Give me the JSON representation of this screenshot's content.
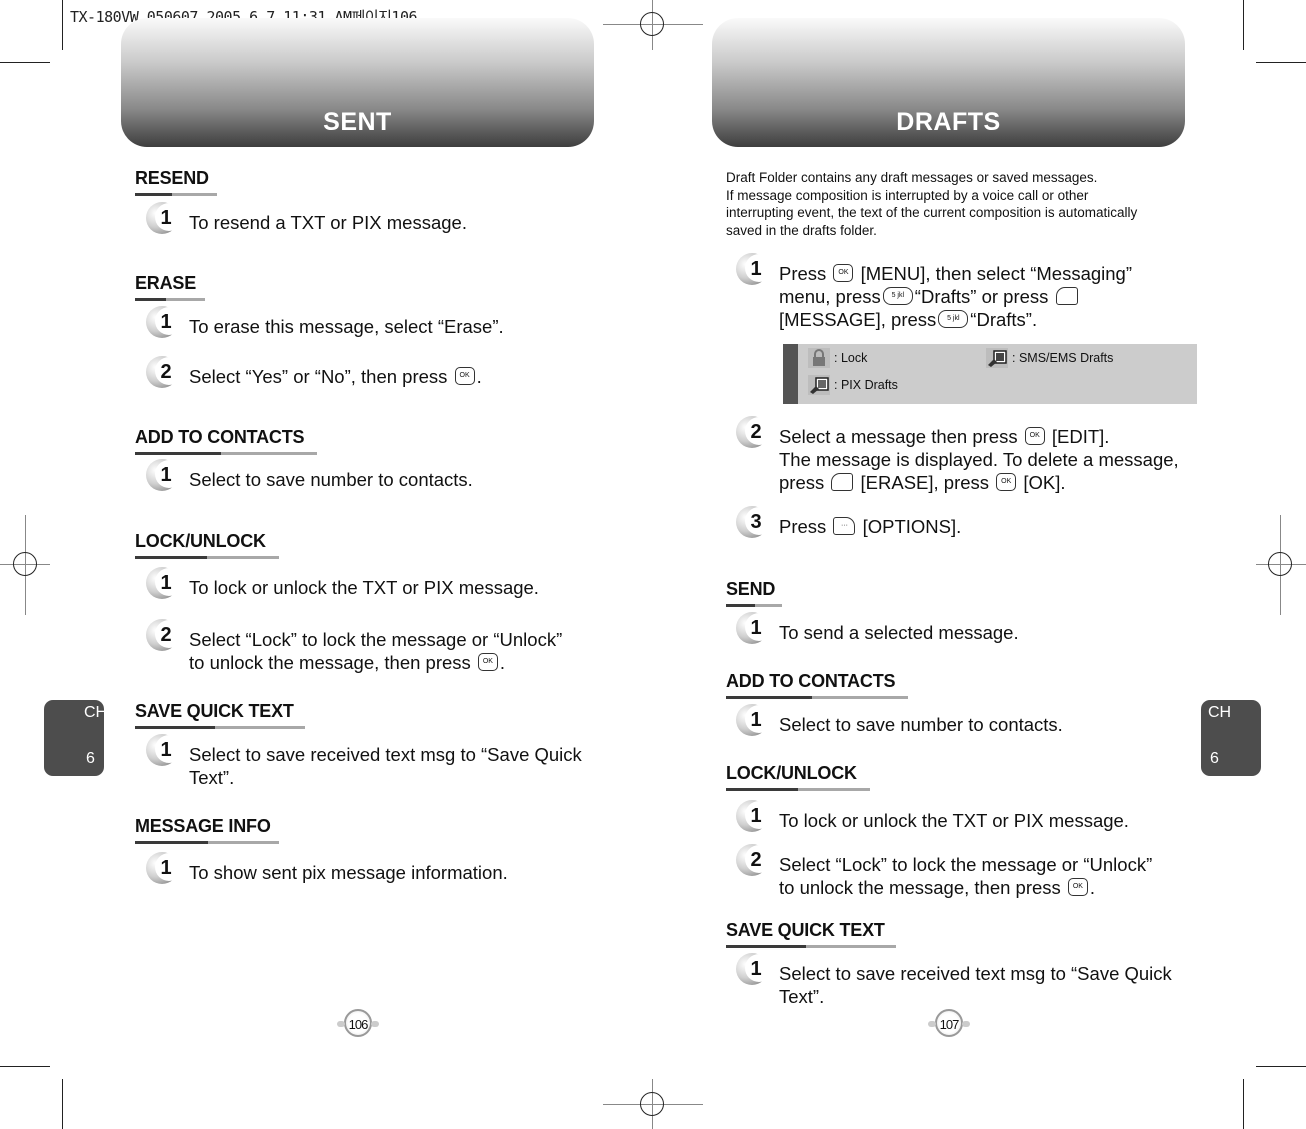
{
  "print_slug": "TX-180VW_050607  2005.6.7 11:31 AM페이지106",
  "left_page": {
    "title": "SENT",
    "chapter": {
      "ch": "CH",
      "num": "6"
    },
    "page_number": "106",
    "sections": [
      {
        "heading": "RESEND",
        "steps": [
          {
            "n": "1",
            "text": "To resend a TXT or PIX message."
          }
        ]
      },
      {
        "heading": "ERASE",
        "steps": [
          {
            "n": "1",
            "text": "To erase this message, select “Erase”."
          },
          {
            "n": "2",
            "text_before": "Select “Yes” or “No”, then press",
            "key": "OK",
            "text_after": "."
          }
        ]
      },
      {
        "heading": "ADD TO CONTACTS",
        "steps": [
          {
            "n": "1",
            "text": "Select to save number to contacts."
          }
        ]
      },
      {
        "heading": "LOCK/UNLOCK",
        "steps": [
          {
            "n": "1",
            "text": "To lock or unlock the TXT or PIX message."
          },
          {
            "n": "2",
            "line1": "Select “Lock” to lock the message or “Unlock”",
            "line2_before": "to unlock the message, then press",
            "key": "OK",
            "line2_after": "."
          }
        ]
      },
      {
        "heading": "SAVE QUICK TEXT",
        "steps": [
          {
            "n": "1",
            "line1": "Select to save received text msg to “Save Quick",
            "line2": "Text”."
          }
        ]
      },
      {
        "heading": "MESSAGE INFO",
        "steps": [
          {
            "n": "1",
            "text": "To show sent pix message information."
          }
        ]
      }
    ]
  },
  "right_page": {
    "title": "DRAFTS",
    "chapter": {
      "ch": "CH",
      "num": "6"
    },
    "page_number": "107",
    "intro": [
      "Draft Folder contains any draft messages or saved messages.",
      "If message composition is interrupted by a voice call or other",
      "interrupting event, the text of the current composition is automatically",
      "saved in the drafts folder."
    ],
    "steps": [
      {
        "n": "1",
        "l1a": "Press",
        "l1key": "OK",
        "l1b": "[MENU], then select “Messaging”",
        "l2a": "menu, press",
        "l2key": "5 jkl",
        "l2b": "“Drafts” or press",
        "l3a": "[MESSAGE], press",
        "l3key": "5 jkl",
        "l3b": "“Drafts”."
      },
      {
        "n": "2",
        "l1a": "Select a message then press",
        "l1key": "OK",
        "l1b": "[EDIT].",
        "l2": "The message is displayed. To delete a message,",
        "l3a": "press",
        "l3b": "[ERASE], press",
        "l3key": "OK",
        "l3c": "[OK]."
      },
      {
        "n": "3",
        "l1a": "Press",
        "l1b": "[OPTIONS]."
      }
    ],
    "legend": [
      {
        "icon": "lock-icon",
        "label": ": Lock"
      },
      {
        "icon": "sms-ems-drafts-icon",
        "label": ": SMS/EMS Drafts"
      },
      {
        "icon": "pix-drafts-icon",
        "label": ": PIX Drafts"
      }
    ],
    "sections": [
      {
        "heading": "SEND",
        "steps": [
          {
            "n": "1",
            "text": "To send a selected message."
          }
        ]
      },
      {
        "heading": "ADD TO CONTACTS",
        "steps": [
          {
            "n": "1",
            "text": "Select to save number to contacts."
          }
        ]
      },
      {
        "heading": "LOCK/UNLOCK",
        "steps": [
          {
            "n": "1",
            "text": "To lock or unlock the TXT or PIX message."
          },
          {
            "n": "2",
            "line1": "Select “Lock” to lock the message or “Unlock”",
            "line2_before": "to unlock the message, then press",
            "key": "OK",
            "line2_after": "."
          }
        ]
      },
      {
        "heading": "SAVE QUICK TEXT",
        "steps": [
          {
            "n": "1",
            "line1": "Select to save received text msg to “Save Quick",
            "line2": "Text”."
          }
        ]
      }
    ]
  }
}
